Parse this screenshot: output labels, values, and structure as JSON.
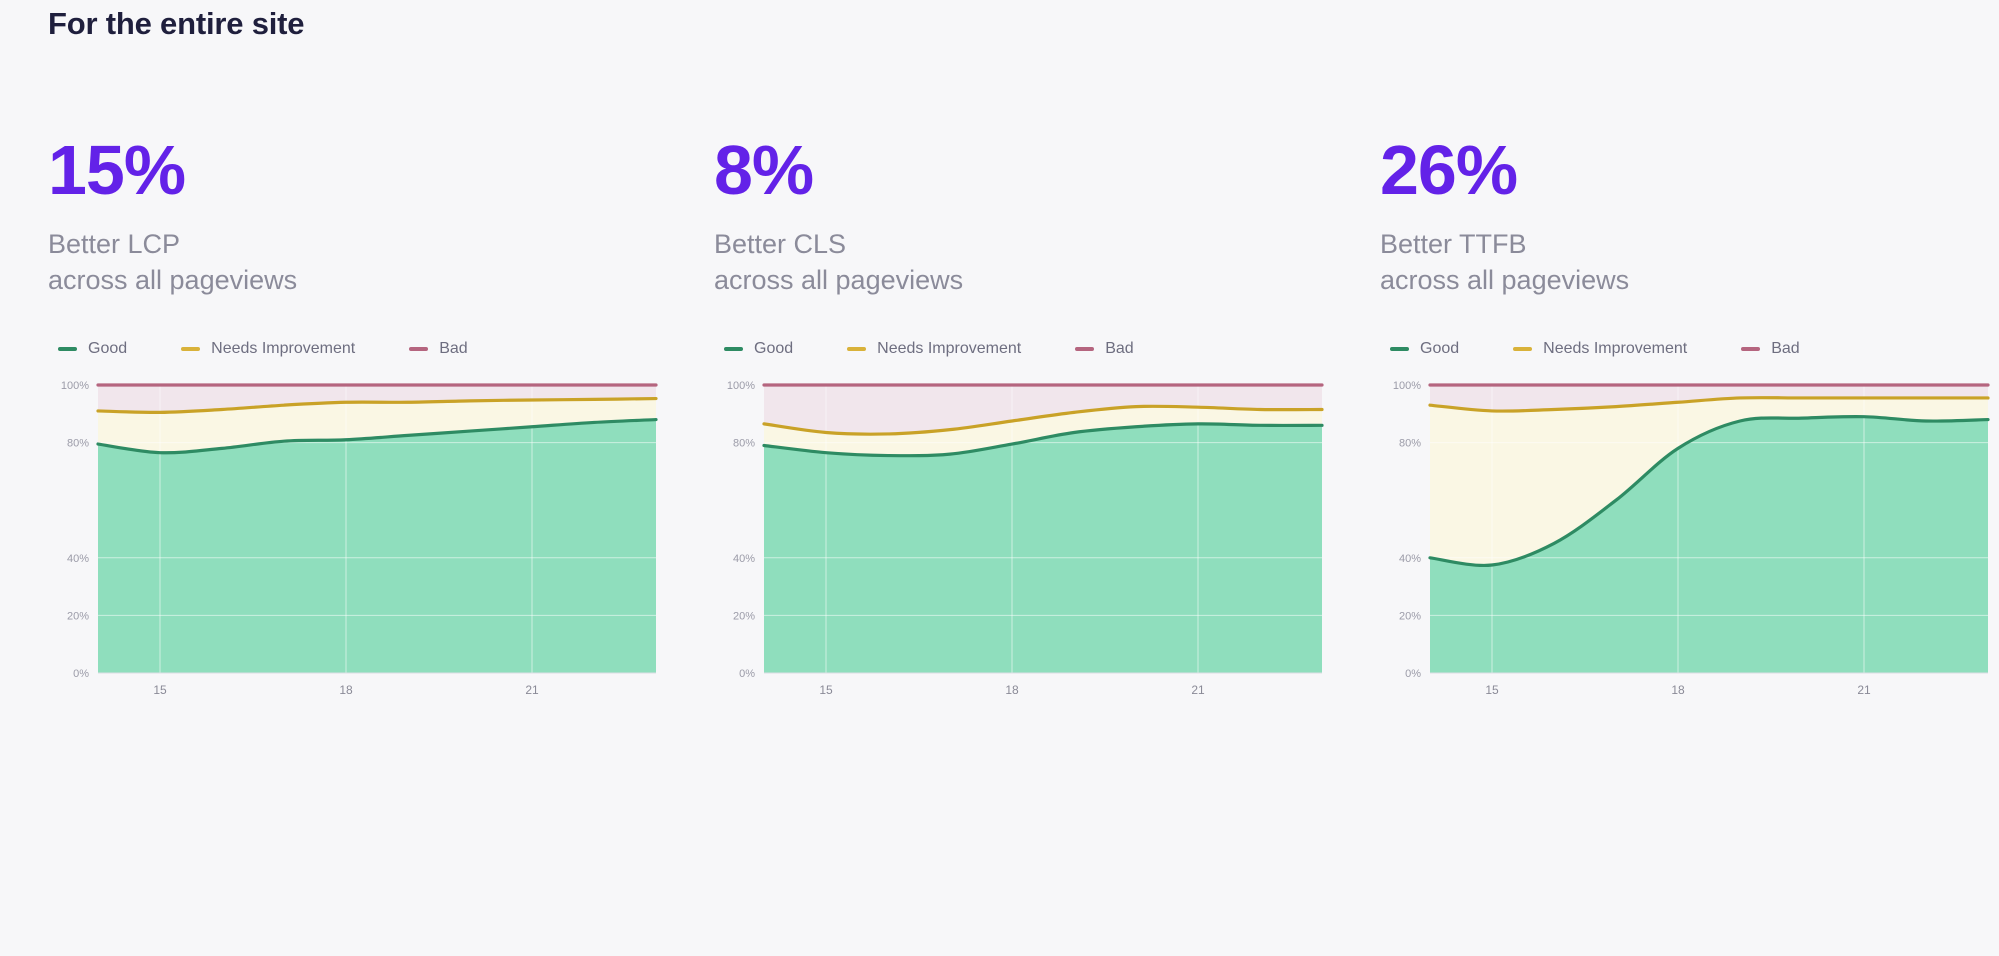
{
  "page": {
    "title": "For the entire site",
    "background": "#F7F7F9"
  },
  "colors": {
    "accent_purple": "#6322E8",
    "title_color": "#1F1F3D",
    "label_gray": "#8B8B9A",
    "good_line": "#2E8B63",
    "good_fill": "#8FDEBD",
    "needs_improvement_line": "#C9A227",
    "needs_improvement_fill": "#FAF7E4",
    "bad_line": "#B5657F",
    "bad_fill": "#F1E6EC"
  },
  "legend": {
    "items": [
      {
        "label": "Good",
        "color": "#2E8B63"
      },
      {
        "label": "Needs Improvement",
        "color": "#C9A227"
      },
      {
        "label": "Bad",
        "color": "#B5657F"
      }
    ]
  },
  "cards": [
    {
      "id": "lcp",
      "value": "15%",
      "label_line1": "Better LCP",
      "label_line2": "across all pageviews"
    },
    {
      "id": "cls",
      "value": "8%",
      "label_line1": "Better CLS",
      "label_line2": "across all pageviews"
    },
    {
      "id": "ttfb",
      "value": "26%",
      "label_line1": "Better TTFB",
      "label_line2": "across all pageviews"
    }
  ],
  "chart_data": [
    {
      "type": "area",
      "id": "lcp",
      "title": "Better LCP across all pageviews",
      "stacked": true,
      "xlabel": "",
      "ylabel": "",
      "ylim": [
        0,
        100
      ],
      "yticks": [
        0,
        20,
        40,
        80,
        100
      ],
      "ytick_labels": [
        "0%",
        "20%",
        "40%",
        "80%",
        "100%"
      ],
      "xticks": [
        15,
        18,
        21
      ],
      "xtick_labels": [
        "15",
        "18",
        "21"
      ],
      "grid": true,
      "legend_position": "top-left",
      "x": [
        14,
        15,
        16,
        17,
        18,
        19,
        20,
        21,
        22,
        23
      ],
      "series": [
        {
          "name": "Good",
          "values": [
            79.5,
            76.5,
            78.0,
            80.5,
            81.0,
            82.5,
            84.0,
            85.5,
            87.0,
            88.0
          ]
        },
        {
          "name": "Needs Improvement",
          "values": [
            11.5,
            14.0,
            13.5,
            12.5,
            13.0,
            11.5,
            10.5,
            9.3,
            8.0,
            7.3
          ]
        },
        {
          "name": "Bad",
          "values": [
            9.0,
            9.5,
            8.5,
            7.0,
            6.0,
            6.0,
            5.5,
            5.2,
            5.0,
            4.7
          ]
        }
      ],
      "cumulative_good_top": [
        79.5,
        76.5,
        78.0,
        80.5,
        81.0,
        82.5,
        84.0,
        85.5,
        87.0,
        88.0
      ],
      "cumulative_ni_top": [
        91.0,
        90.5,
        91.5,
        93.0,
        94.0,
        94.0,
        94.5,
        94.8,
        95.0,
        95.3
      ]
    },
    {
      "type": "area",
      "id": "cls",
      "title": "Better CLS across all pageviews",
      "stacked": true,
      "xlabel": "",
      "ylabel": "",
      "ylim": [
        0,
        100
      ],
      "yticks": [
        0,
        20,
        40,
        80,
        100
      ],
      "ytick_labels": [
        "0%",
        "20%",
        "40%",
        "80%",
        "100%"
      ],
      "xticks": [
        15,
        18,
        21
      ],
      "xtick_labels": [
        "15",
        "18",
        "21"
      ],
      "grid": true,
      "legend_position": "top-left",
      "x": [
        14,
        15,
        16,
        17,
        18,
        19,
        20,
        21,
        22,
        23
      ],
      "series": [
        {
          "name": "Good",
          "values": [
            79.0,
            76.5,
            75.5,
            76.0,
            79.5,
            83.5,
            85.5,
            86.5,
            86.0,
            86.0
          ]
        },
        {
          "name": "Needs Improvement",
          "values": [
            7.5,
            7.0,
            7.5,
            8.5,
            8.0,
            7.0,
            7.0,
            5.8,
            5.5,
            5.5
          ]
        },
        {
          "name": "Bad",
          "values": [
            13.5,
            16.5,
            17.0,
            15.5,
            12.5,
            9.5,
            7.5,
            7.7,
            8.5,
            8.5
          ]
        }
      ],
      "cumulative_good_top": [
        79.0,
        76.5,
        75.5,
        76.0,
        79.5,
        83.5,
        85.5,
        86.5,
        86.0,
        86.0
      ],
      "cumulative_ni_top": [
        86.5,
        83.5,
        83.0,
        84.5,
        87.5,
        90.5,
        92.5,
        92.3,
        91.5,
        91.5
      ]
    },
    {
      "type": "area",
      "id": "ttfb",
      "title": "Better TTFB across all pageviews",
      "stacked": true,
      "xlabel": "",
      "ylabel": "",
      "ylim": [
        0,
        100
      ],
      "yticks": [
        0,
        20,
        40,
        80,
        100
      ],
      "ytick_labels": [
        "0%",
        "20%",
        "40%",
        "80%",
        "100%"
      ],
      "xticks": [
        15,
        18,
        21
      ],
      "xtick_labels": [
        "15",
        "18",
        "21"
      ],
      "grid": true,
      "legend_position": "top-left",
      "x": [
        14,
        15,
        16,
        17,
        18,
        19,
        20,
        21,
        22,
        23
      ],
      "series": [
        {
          "name": "Good",
          "values": [
            40.0,
            37.5,
            45.0,
            60.0,
            78.0,
            87.5,
            88.5,
            89.0,
            87.5,
            88.0
          ]
        },
        {
          "name": "Needs Improvement",
          "values": [
            53.0,
            53.5,
            46.5,
            32.5,
            16.0,
            8.0,
            7.0,
            6.5,
            8.0,
            7.5
          ]
        },
        {
          "name": "Bad",
          "values": [
            7.0,
            9.0,
            8.5,
            7.5,
            6.0,
            4.5,
            4.5,
            4.5,
            4.5,
            4.5
          ]
        }
      ],
      "cumulative_good_top": [
        40.0,
        37.5,
        45.0,
        60.0,
        78.0,
        87.5,
        88.5,
        89.0,
        87.5,
        88.0
      ],
      "cumulative_ni_top": [
        93.0,
        91.0,
        91.5,
        92.5,
        94.0,
        95.5,
        95.5,
        95.5,
        95.5,
        95.5
      ]
    }
  ]
}
